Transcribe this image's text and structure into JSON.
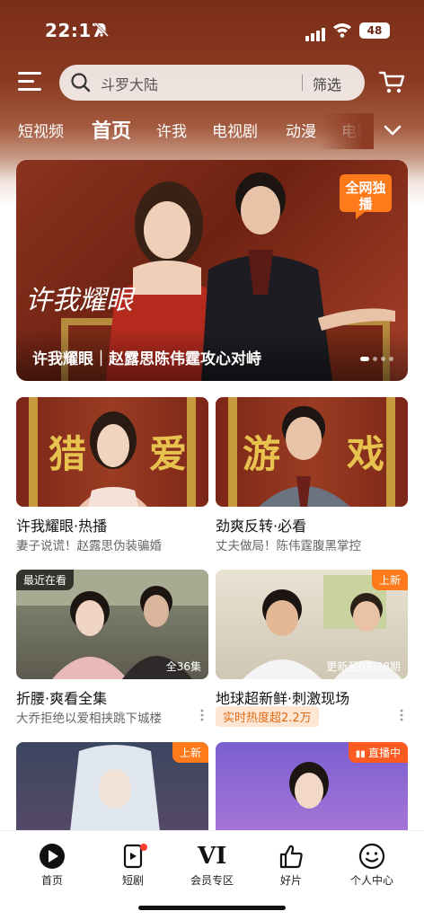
{
  "status_bar": {
    "time": "22:17",
    "battery": "48"
  },
  "search": {
    "query": "斗罗大陆",
    "filter_label": "筛选"
  },
  "tabs": [
    {
      "label": "短视频"
    },
    {
      "label": "首页",
      "active": true
    },
    {
      "label": "许我"
    },
    {
      "label": "电视剧"
    },
    {
      "label": "动漫"
    },
    {
      "label": "电影"
    }
  ],
  "banner": {
    "title": "许我耀眼｜赵露思陈伟霆攻心对峙",
    "badge": "全网独播",
    "art_title": "许我耀眼"
  },
  "cards": [
    {
      "title": "许我耀眼·热播",
      "subtitle": "妻子说谎！赵露思伪装骗婚",
      "art_chars": [
        "猎",
        "爱"
      ]
    },
    {
      "title": "劲爽反转·必看",
      "subtitle": "丈夫做局！陈伟霆腹黑掌控",
      "art_chars": [
        "游",
        "戏"
      ]
    },
    {
      "title": "折腰·爽看全集",
      "subtitle": "大乔拒绝以爱相挟跳下城楼",
      "tag": "最近在看",
      "caption": "全36集"
    },
    {
      "title": "地球超新鲜·刺激现场",
      "hot": "实时热度超2.2万",
      "tag": "上新",
      "caption": "更新至09-28期"
    },
    {
      "tag": "上新"
    },
    {
      "tag": "直播中"
    }
  ],
  "bottom_nav": [
    {
      "label": "首页"
    },
    {
      "label": "短剧"
    },
    {
      "label": "会员专区",
      "mark": "VI"
    },
    {
      "label": "好片"
    },
    {
      "label": "个人中心"
    }
  ],
  "colors": {
    "accent_orange": "#ff7a1a",
    "header_brown": "#7a2d18",
    "hot_text": "#e26a14"
  }
}
